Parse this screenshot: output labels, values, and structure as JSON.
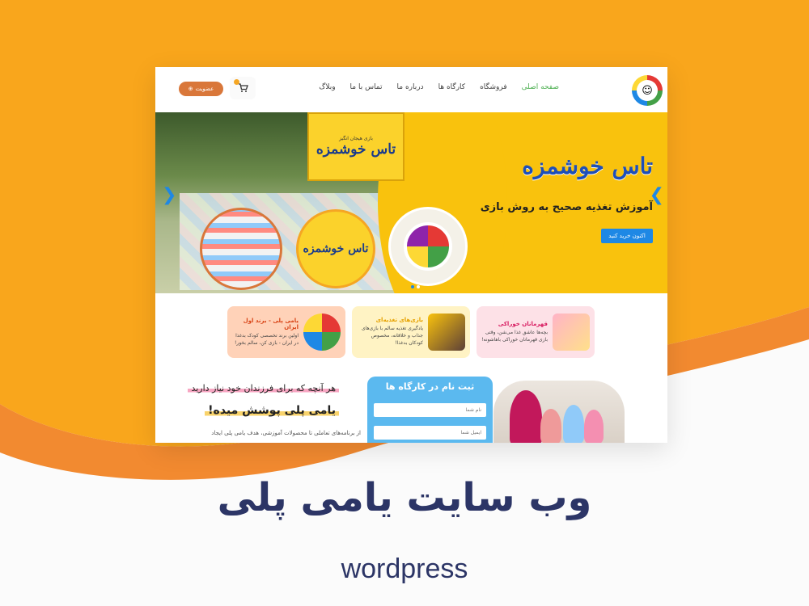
{
  "colors": {
    "background_orange": "#f9a61c",
    "swoosh": "#f28a30",
    "accent_blue": "#1e88e5",
    "title_navy": "#2c3566"
  },
  "header": {
    "nav": [
      "صفحه اصلی",
      "فروشگاه",
      "کارگاه ها",
      "درباره ما",
      "تماس با ما",
      "وبلاگ"
    ],
    "member_button": "عضویت",
    "cart_icon": "cart-icon"
  },
  "hero": {
    "title": "تاس خوشمزه",
    "subtitle": "آموزش تغذیه صحیح به روش بازی",
    "cta": "اکنون خرید کنید",
    "box_title": "تاس خوشمزه",
    "box_caption": "بازی هیجان انگیز",
    "slide_count": 2,
    "active_slide": 2
  },
  "cards": [
    {
      "title": "قهرمانان خوراکی",
      "desc": "بچه‌ها عاشق غذا می‌شن، وقتی بازی قهرمانان خوراکی باهاشونه!",
      "color": "#fde1e7",
      "title_color": "#d81b60"
    },
    {
      "title": "بازی‌های تغذیه‌ای",
      "desc": "یادگیری تغذیه سالم با بازی‌های جذاب و خلاقانه، مخصوص کودکان بدغذا!",
      "color": "#fff3c4",
      "title_color": "#e6a100"
    },
    {
      "title": "یامی پلی - برند اول ایران",
      "desc": "اولین برند تخصصی کودک بدغذا در ایران - بازی کن، سالم بخور!",
      "color": "#ffd2b8",
      "title_color": "#d84315"
    }
  ],
  "intro": {
    "line1": "هر آنچه که برای فرزندان خود نیاز دارید",
    "line2": "یامی پلی پوشش میده!",
    "para": "از برنامه‌های تعاملی تا محصولات آموزشی، هدف یامی پلی ایجاد"
  },
  "register": {
    "title": "ثبت نام در کارگاه ها",
    "name_placeholder": "نام شما",
    "email_placeholder": "ایمیل شما"
  },
  "footer_title": {
    "title": "وب سایت  یامی پلی",
    "subtitle": "wordpress"
  }
}
